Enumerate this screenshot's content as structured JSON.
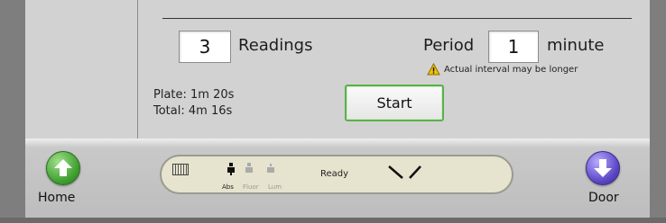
{
  "readings": {
    "value": "3",
    "label": "Readings"
  },
  "period": {
    "label": "Period",
    "value": "1",
    "unit": "minute",
    "warning": "Actual interval may be longer"
  },
  "timing": {
    "plate": "Plate: 1m 20s",
    "total": "Total: 4m 16s"
  },
  "start_label": "Start",
  "nav": {
    "home_label": "Home",
    "door_label": "Door"
  },
  "status": {
    "modes": [
      "Abs",
      "Fluor",
      "Lum"
    ],
    "ready": "Ready"
  },
  "colors": {
    "start_border": "#59b24a",
    "home": "#3f9f2f",
    "door": "#5a45c5",
    "warning": "#f2c200"
  },
  "icons": {
    "home": "home-up-arrow-icon",
    "door": "door-down-arrow-icon",
    "warning": "warning-triangle-icon",
    "keyboard": "keyboard-icon"
  }
}
